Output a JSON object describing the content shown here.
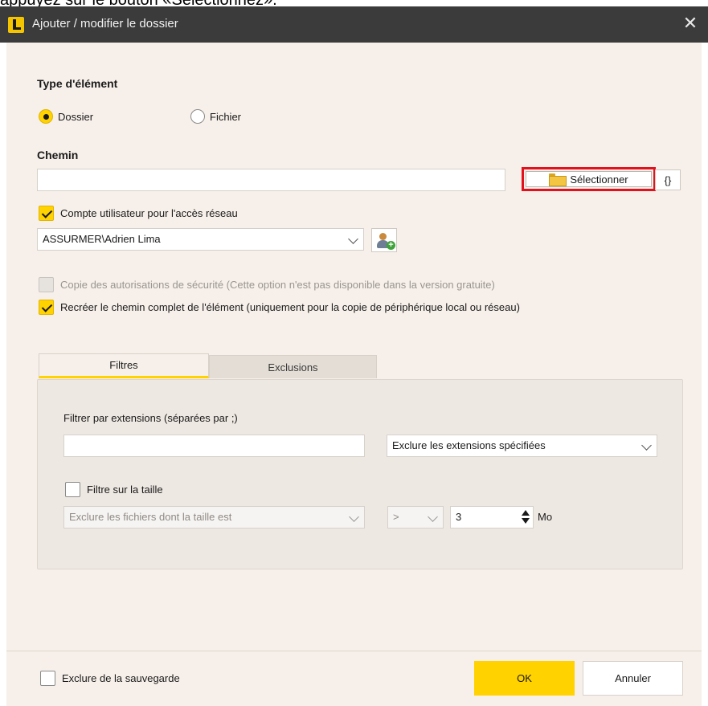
{
  "caption_fragment": "appuyez sur le bouton «Sélectionnez».",
  "window": {
    "title": "Ajouter / modifier le dossier",
    "close_glyph": "✕"
  },
  "type_section": {
    "heading": "Type d'élément",
    "options": [
      {
        "label": "Dossier",
        "selected": true
      },
      {
        "label": "Fichier",
        "selected": false
      }
    ]
  },
  "path_section": {
    "heading": "Chemin",
    "path_value": "",
    "select_button_label": "Sélectionner",
    "variables_button_label": "{}"
  },
  "network": {
    "account_checkbox_label": "Compte utilisateur pour l'accès réseau",
    "account_checked": true,
    "account_value": "ASSURMER\\Adrien Lima"
  },
  "options": {
    "copy_permissions_label": "Copie des autorisations de sécurité (Cette option n'est pas disponible dans la version gratuite)",
    "copy_permissions_checked": false,
    "recreate_path_label": "Recréer le chemin complet de l'élément (uniquement pour la copie de périphérique local ou réseau)",
    "recreate_path_checked": true
  },
  "tabs": [
    {
      "label": "Filtres",
      "active": true
    },
    {
      "label": "Exclusions",
      "active": false
    }
  ],
  "filters": {
    "extensions_label": "Filtrer par extensions (séparées par ;)",
    "extensions_value": "",
    "extensions_mode": "Exclure les extensions spécifiées",
    "size_filter_label": "Filtre sur la taille",
    "size_filter_checked": false,
    "size_mode": "Exclure les fichiers dont la taille est",
    "operator": ">",
    "size_value": "3",
    "size_unit": "Mo"
  },
  "footer": {
    "exclude_label": "Exclure de la sauvegarde",
    "exclude_checked": false,
    "ok_label": "OK",
    "cancel_label": "Annuler"
  },
  "colors": {
    "accent": "#ffd200",
    "highlight_border": "#e4101b",
    "titlebar": "#3b3b3b",
    "dialog_bg": "#f7f0ea"
  }
}
